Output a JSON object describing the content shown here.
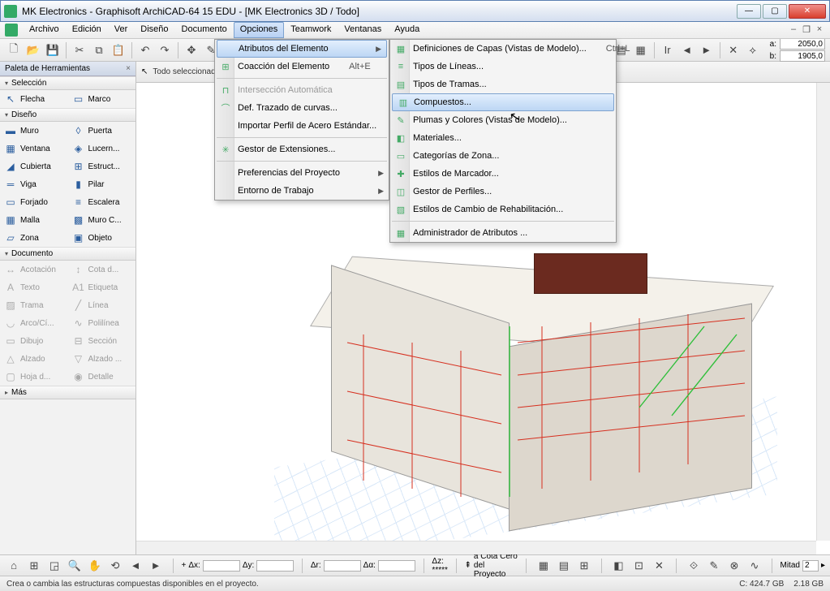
{
  "window": {
    "title": "MK Electronics - Graphisoft ArchiCAD-64 15 EDU - [MK Electronics 3D / Todo]"
  },
  "menubar": {
    "items": [
      "Archivo",
      "Edición",
      "Ver",
      "Diseño",
      "Documento",
      "Opciones",
      "Teamwork",
      "Ventanas",
      "Ayuda"
    ],
    "active": "Opciones"
  },
  "dropdown1": {
    "items": [
      {
        "label": "Atributos del Elemento",
        "submenu": true,
        "hl": true
      },
      {
        "label": "Coacción del Elemento",
        "shortcut": "Alt+E",
        "icon": "⊞"
      },
      {
        "sep": true
      },
      {
        "label": "Intersección Automática",
        "disabled": true,
        "icon": "⊓"
      },
      {
        "label": "Def. Trazado de curvas...",
        "icon": "⌒"
      },
      {
        "label": "Importar Perfil de Acero Estándar..."
      },
      {
        "sep": true
      },
      {
        "label": "Gestor de Extensiones...",
        "icon": "✳"
      },
      {
        "sep": true
      },
      {
        "label": "Preferencias del Proyecto",
        "submenu": true
      },
      {
        "label": "Entorno de Trabajo",
        "submenu": true
      }
    ]
  },
  "dropdown2": {
    "items": [
      {
        "label": "Definiciones de Capas (Vistas de Modelo)...",
        "shortcut": "Ctrl+L",
        "icon": "▦"
      },
      {
        "label": "Tipos de Líneas...",
        "icon": "≡"
      },
      {
        "label": "Tipos de Tramas...",
        "icon": "▤"
      },
      {
        "label": "Compuestos...",
        "icon": "▥",
        "hl": true
      },
      {
        "label": "Plumas y Colores (Vistas de Modelo)...",
        "icon": "✎"
      },
      {
        "label": "Materiales...",
        "icon": "◧"
      },
      {
        "label": "Categorías de Zona...",
        "icon": "▭"
      },
      {
        "label": "Estilos de Marcador...",
        "icon": "✚"
      },
      {
        "label": "Gestor de Perfiles...",
        "icon": "◫"
      },
      {
        "label": "Estilos de Cambio de Rehabilitación...",
        "icon": "▧"
      },
      {
        "sep": true
      },
      {
        "label": "Administrador de Atributos ...",
        "icon": "▦"
      }
    ]
  },
  "palette": {
    "title": "Paleta de Herramientas",
    "sections": {
      "seleccion": {
        "title": "Selección",
        "tools": [
          {
            "label": "Flecha",
            "icon": "↖"
          },
          {
            "label": "Marco",
            "icon": "▭"
          }
        ]
      },
      "diseno": {
        "title": "Diseño",
        "tools": [
          {
            "label": "Muro",
            "icon": "▬"
          },
          {
            "label": "Puerta",
            "icon": "◊"
          },
          {
            "label": "Ventana",
            "icon": "▦"
          },
          {
            "label": "Lucern...",
            "icon": "◈"
          },
          {
            "label": "Cubierta",
            "icon": "◢"
          },
          {
            "label": "Estruct...",
            "icon": "⊞"
          },
          {
            "label": "Viga",
            "icon": "═"
          },
          {
            "label": "Pilar",
            "icon": "▮"
          },
          {
            "label": "Forjado",
            "icon": "▭"
          },
          {
            "label": "Escalera",
            "icon": "≡"
          },
          {
            "label": "Malla",
            "icon": "▦"
          },
          {
            "label": "Muro C...",
            "icon": "▩"
          },
          {
            "label": "Zona",
            "icon": "▱"
          },
          {
            "label": "Objeto",
            "icon": "▣"
          }
        ]
      },
      "documento": {
        "title": "Documento",
        "tools": [
          {
            "label": "Acotación",
            "icon": "↔"
          },
          {
            "label": "Cota d...",
            "icon": "↕"
          },
          {
            "label": "Texto",
            "icon": "A"
          },
          {
            "label": "Etiqueta",
            "icon": "A1"
          },
          {
            "label": "Trama",
            "icon": "▨"
          },
          {
            "label": "Línea",
            "icon": "╱"
          },
          {
            "label": "Arco/Cí...",
            "icon": "◡"
          },
          {
            "label": "Polilínea",
            "icon": "∿"
          },
          {
            "label": "Dibujo",
            "icon": "▭"
          },
          {
            "label": "Sección",
            "icon": "⊟"
          },
          {
            "label": "Alzado",
            "icon": "△"
          },
          {
            "label": "Alzado ...",
            "icon": "▽"
          },
          {
            "label": "Hoja d...",
            "icon": "▢"
          },
          {
            "label": "Detalle",
            "icon": "◉"
          }
        ]
      },
      "mas": {
        "title": "Más"
      }
    }
  },
  "infobox": {
    "label": "Todo seleccionado:"
  },
  "coords": {
    "a": "2050,0",
    "b": "1905,0"
  },
  "bottombar": {
    "mid_label": "a Cota Cero del Proyecto",
    "scale_label": "Mitad",
    "scale_val": "2"
  },
  "statusbar": {
    "hint": "Crea o cambia las estructuras compuestas disponibles en el proyecto.",
    "disk_c": "C: 424.7 GB",
    "disk_other": "2.18 GB"
  }
}
